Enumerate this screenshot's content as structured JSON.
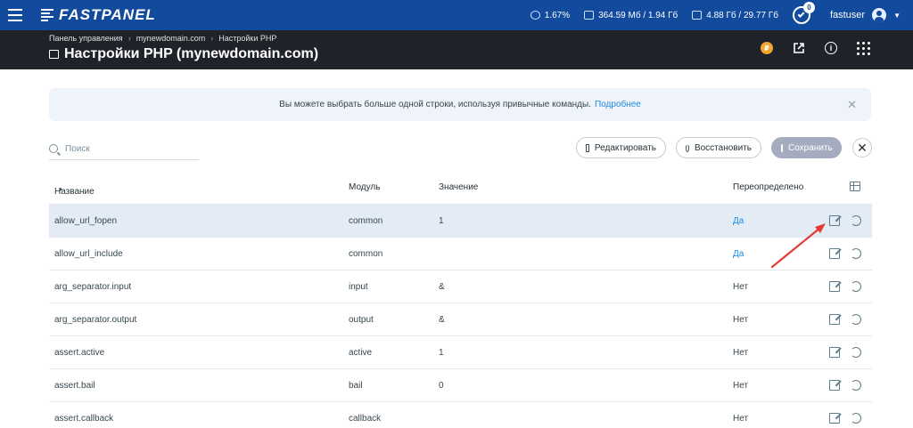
{
  "topbar": {
    "brand": "FASTPANEL",
    "stats": [
      {
        "icon": "cpu-icon",
        "value": "1.67%"
      },
      {
        "icon": "memory-icon",
        "value": "364.59 Мб / 1.94 Гб"
      },
      {
        "icon": "disk-icon",
        "value": "4.88 Гб / 29.77 Гб"
      }
    ],
    "notifications_count": "0",
    "username": "fastuser"
  },
  "header": {
    "breadcrumbs": [
      "Панель управления",
      "mynewdomain.com",
      "Настройки PHP"
    ],
    "title": "Настройки PHP (mynewdomain.com)"
  },
  "banner": {
    "text": "Вы можете выбрать больше одной строки, используя привычные команды.",
    "link": "Подробнее"
  },
  "toolbar": {
    "search_placeholder": "Поиск",
    "edit_label": "Редактировать",
    "restore_label": "Восстановить",
    "save_label": "Сохранить"
  },
  "table": {
    "columns": {
      "name": "Название",
      "module": "Модуль",
      "value": "Значение",
      "overridden": "Переопределено"
    },
    "rows": [
      {
        "name": "allow_url_fopen",
        "module": "common",
        "value": "1",
        "overridden": "Да"
      },
      {
        "name": "allow_url_include",
        "module": "common",
        "value": "",
        "overridden": "Да"
      },
      {
        "name": "arg_separator.input",
        "module": "input",
        "value": "&",
        "overridden": "Нет"
      },
      {
        "name": "arg_separator.output",
        "module": "output",
        "value": "&",
        "overridden": "Нет"
      },
      {
        "name": "assert.active",
        "module": "active",
        "value": "1",
        "overridden": "Нет"
      },
      {
        "name": "assert.bail",
        "module": "bail",
        "value": "0",
        "overridden": "Нет"
      },
      {
        "name": "assert.callback",
        "module": "callback",
        "value": "",
        "overridden": "Нет"
      }
    ]
  },
  "colors": {
    "topbar": "#124b9e",
    "header": "#1f2229",
    "accent": "#1e88e5",
    "arrow": "#e53935"
  }
}
